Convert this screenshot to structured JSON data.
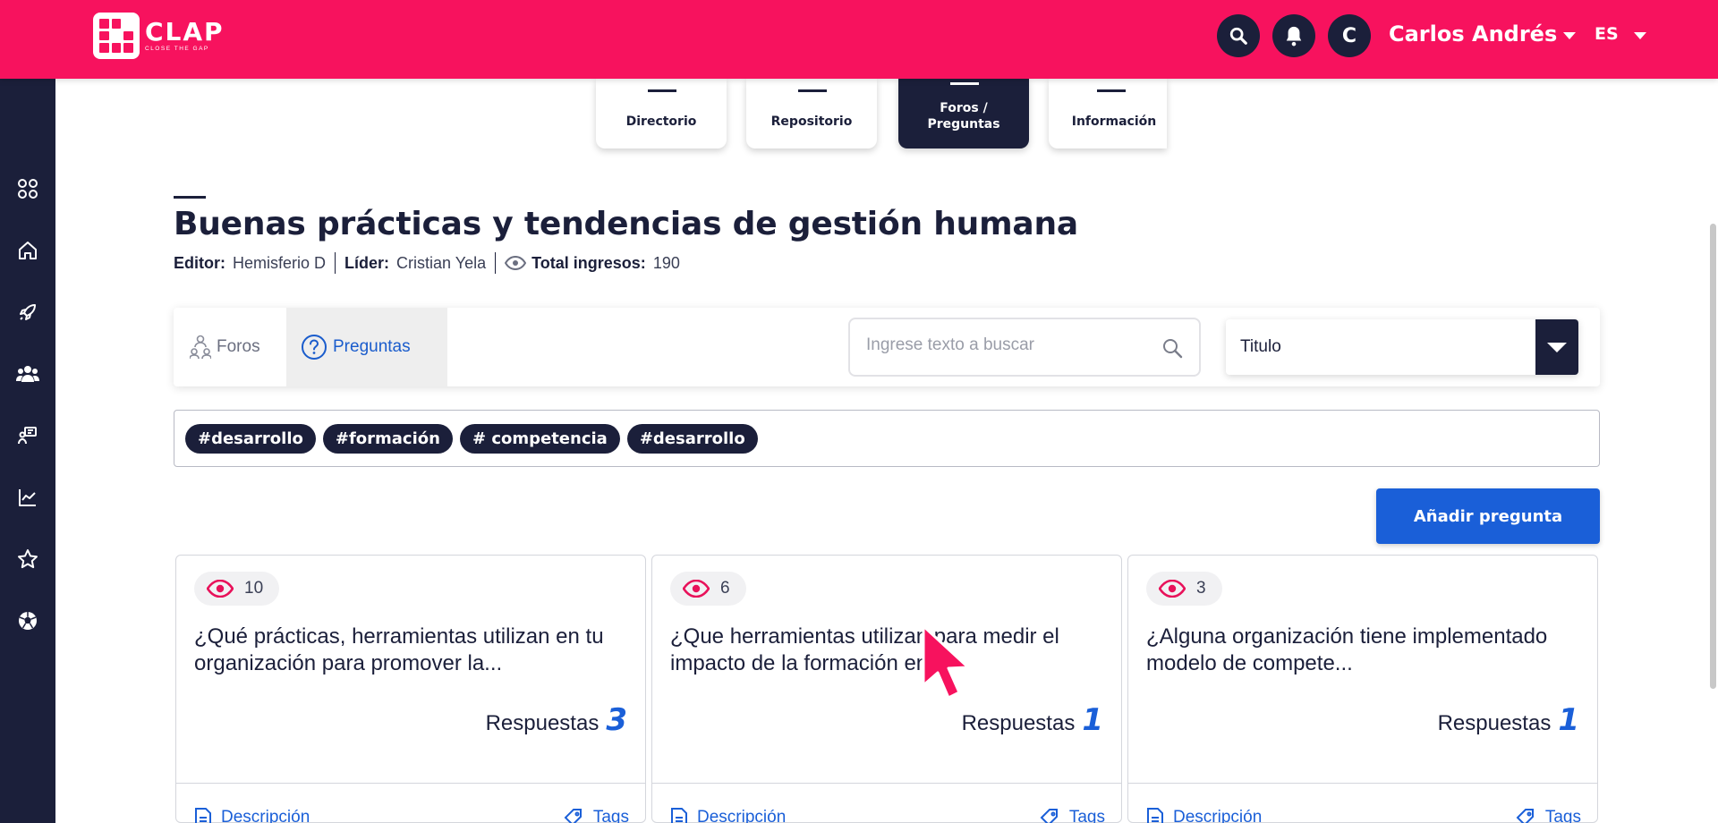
{
  "brand": {
    "name": "CLAP",
    "tagline": "CLOSE THE GAP",
    "color": "#f7125e"
  },
  "header": {
    "user_initial": "C",
    "user_name": "Carlos Andrés",
    "language": "ES"
  },
  "sidebar": {
    "items": [
      {
        "icon": "grid-icon"
      },
      {
        "icon": "home-icon"
      },
      {
        "icon": "rocket-icon"
      },
      {
        "icon": "users-icon"
      },
      {
        "icon": "forum-icon"
      },
      {
        "icon": "chart-icon"
      },
      {
        "icon": "star-icon"
      },
      {
        "icon": "soccer-ball-icon"
      }
    ]
  },
  "nav_tabs": [
    {
      "label": "Directorio"
    },
    {
      "label": "Repositorio"
    },
    {
      "label": "Foros /\nPreguntas",
      "active": true
    },
    {
      "label": "Información"
    }
  ],
  "page": {
    "title": "Buenas prácticas y tendencias de gestión humana",
    "editor_label": "Editor:",
    "editor": "Hemisferio D",
    "leader_label": "Líder:",
    "leader": "Cristian Yela",
    "total_label": "Total ingresos:",
    "total": "190"
  },
  "subtabs": {
    "foros": "Foros",
    "preguntas": "Preguntas"
  },
  "search": {
    "placeholder": "Ingrese texto a buscar"
  },
  "sort": {
    "selected": "Titulo"
  },
  "tags": [
    "#desarrollo",
    "#formación",
    "# competencia",
    "#desarrollo"
  ],
  "add_button": "Añadir pregunta",
  "cards": [
    {
      "views": "10",
      "question": "¿Qué prácticas, herramientas utilizan en tu organización para promover la...",
      "answers_label": "Respuestas",
      "answers": "3",
      "desc_label": "Descripción",
      "tags_label": "Tags"
    },
    {
      "views": "6",
      "question": "¿Que herramientas utilizan para medir el impacto de la formación en...",
      "answers_label": "Respuestas",
      "answers": "1",
      "desc_label": "Descripción",
      "tags_label": "Tags"
    },
    {
      "views": "3",
      "question": "¿Alguna organización tiene implementado modelo de compete...",
      "answers_label": "Respuestas",
      "answers": "1",
      "desc_label": "Descripción",
      "tags_label": "Tags"
    }
  ]
}
